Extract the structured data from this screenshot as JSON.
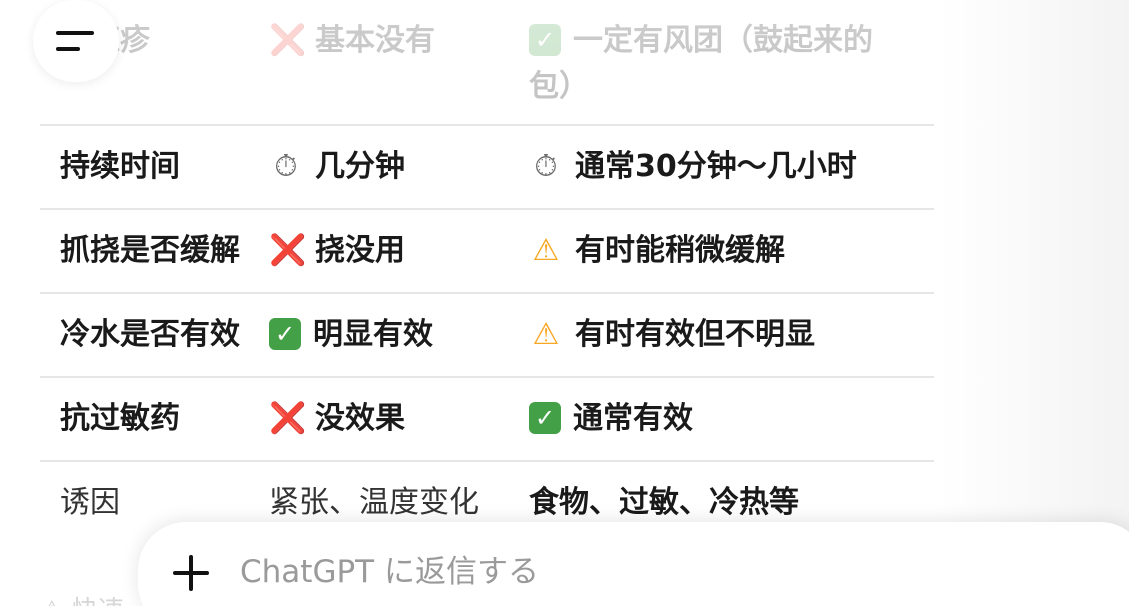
{
  "table": {
    "rows": [
      {
        "label": "有红疹",
        "col2_icon": "cross-mark-icon",
        "col2_emoji": "❌",
        "col2": "基本没有",
        "col3_icon": "check-mark-icon",
        "col3_emoji": "✓",
        "col3": "一定有风团（鼓起来的包）"
      },
      {
        "label": "持续时间",
        "col2_icon": "stopwatch-icon",
        "col2_emoji": "⏱",
        "col2": "几分钟",
        "col3_icon": "stopwatch-icon",
        "col3_emoji": "⏱",
        "col3": "通常30分钟～几小时"
      },
      {
        "label": "抓挠是否缓解",
        "col2_icon": "cross-mark-icon",
        "col2_emoji": "❌",
        "col2": "挠没用",
        "col3_icon": "warning-icon",
        "col3_emoji": "⚠",
        "col3": "有时能稍微缓解"
      },
      {
        "label": "冷水是否有效",
        "col2_icon": "check-mark-icon",
        "col2_emoji": "✓",
        "col2": "明显有效",
        "col3_icon": "warning-icon",
        "col3_emoji": "⚠",
        "col3": "有时有效但不明显"
      },
      {
        "label": "抗过敏药",
        "col2_icon": "cross-mark-icon",
        "col2_emoji": "❌",
        "col2": "没效果",
        "col3_icon": "check-mark-icon",
        "col3_emoji": "✓",
        "col3": "通常有效"
      },
      {
        "label": "诱因",
        "col2": "紧张、温度变化",
        "col3": "食物、过敏、冷热等"
      }
    ]
  },
  "composer": {
    "placeholder": "ChatGPT に返信する"
  },
  "peek_text": "⚠ 快速"
}
